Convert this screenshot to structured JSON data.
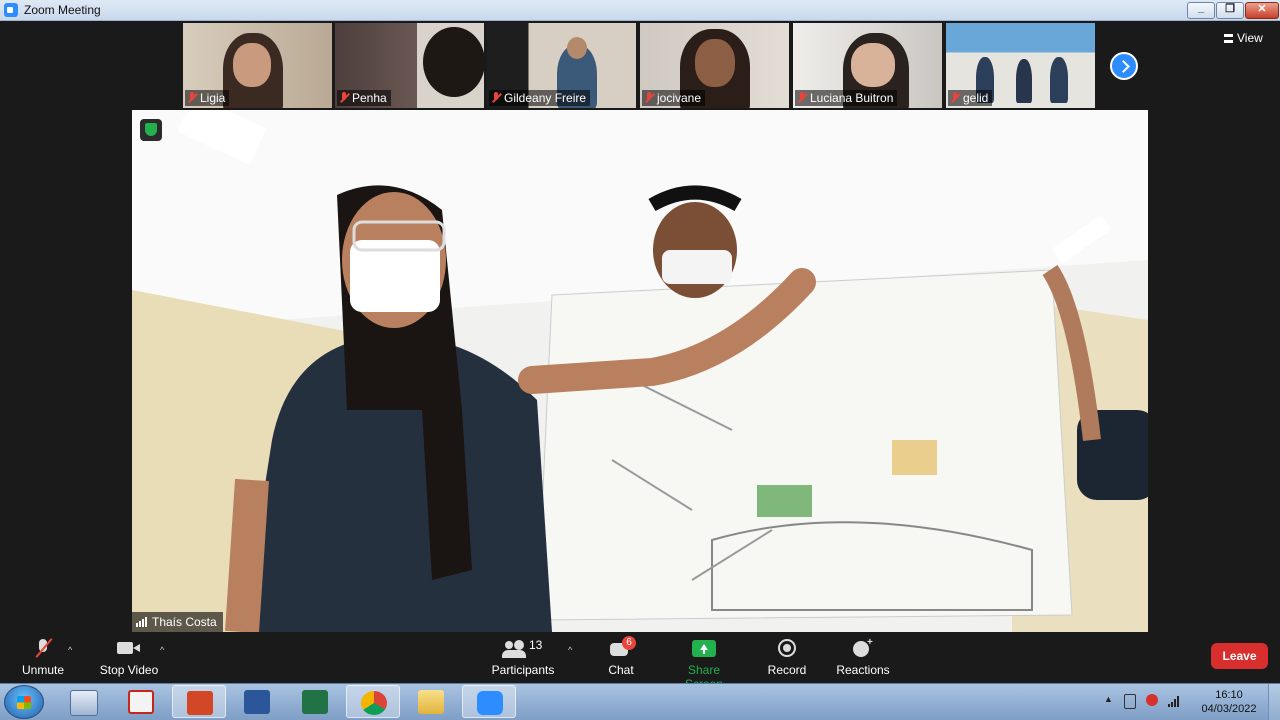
{
  "window": {
    "title": "Zoom Meeting",
    "minimize_label": "_",
    "restore_label": "❐",
    "close_label": "✕"
  },
  "gallery": {
    "participants": [
      {
        "name": "Ligia"
      },
      {
        "name": "Penha"
      },
      {
        "name": "Gildeany Freire"
      },
      {
        "name": "jocivane"
      },
      {
        "name": "Luciana Buitron"
      },
      {
        "name": "gelid"
      }
    ],
    "view_label": "View"
  },
  "main_video": {
    "speaker_name": "Thaís Costa"
  },
  "toolbar": {
    "unmute_label": "Unmute",
    "stop_video_label": "Stop Video",
    "participants_label": "Participants",
    "participants_count": "13",
    "chat_label": "Chat",
    "chat_badge": "6",
    "share_screen_label": "Share Screen",
    "record_label": "Record",
    "reactions_label": "Reactions",
    "leave_label": "Leave",
    "caret": "^"
  },
  "taskbar": {
    "apps": [
      "calculator-icon",
      "pdf-icon",
      "powerpoint-icon",
      "word-icon",
      "excel-icon",
      "chrome-icon",
      "folder-icon",
      "zoom-icon"
    ],
    "time": "16:10",
    "date": "04/03/2022"
  },
  "colors": {
    "accent": "#2d8cff",
    "leave": "#d82e2e",
    "share": "#22b14c",
    "badge": "#e8453c"
  }
}
